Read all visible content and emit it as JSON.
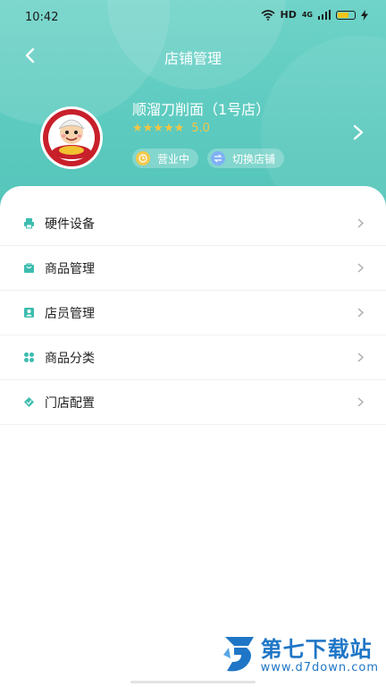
{
  "status_bar": {
    "time": "10:42",
    "network": "HD",
    "signal": "4G"
  },
  "nav": {
    "title": "店铺管理"
  },
  "store": {
    "name": "顺溜刀削面（1号店）",
    "stars": "★★★★★",
    "rating": "5.0",
    "status_label": "营业中",
    "switch_label": "切换店铺"
  },
  "menu": [
    {
      "label": "硬件设备",
      "icon": "printer-icon"
    },
    {
      "label": "商品管理",
      "icon": "bag-icon"
    },
    {
      "label": "店员管理",
      "icon": "contact-card-icon"
    },
    {
      "label": "商品分类",
      "icon": "category-icon"
    },
    {
      "label": "门店配置",
      "icon": "tag-icon"
    }
  ],
  "watermark": {
    "name": "第七下载站",
    "url": "www.d7down.com"
  },
  "colors": {
    "header": "#5ccabf",
    "accent": "#3dbcb0",
    "star": "#f4c545"
  }
}
